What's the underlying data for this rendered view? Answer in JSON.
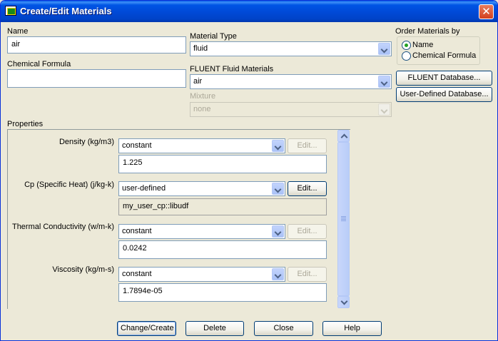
{
  "window": {
    "title": "Create/Edit Materials",
    "close_label": "✕"
  },
  "name": {
    "label": "Name",
    "value": "air"
  },
  "chemical_formula": {
    "label": "Chemical Formula",
    "value": ""
  },
  "material_type": {
    "label": "Material Type",
    "value": "fluid"
  },
  "fluent_fluid_materials": {
    "label": "FLUENT Fluid Materials",
    "value": "air"
  },
  "mixture": {
    "label": "Mixture",
    "value": "none"
  },
  "order_materials": {
    "label": "Order Materials by",
    "options": [
      {
        "label": "Name",
        "checked": true
      },
      {
        "label": "Chemical Formula",
        "checked": false
      }
    ]
  },
  "database_buttons": {
    "fluent": "FLUENT Database...",
    "user_defined": "User-Defined Database..."
  },
  "properties": {
    "label": "Properties",
    "items": [
      {
        "label": "Density (kg/m3)",
        "method": "constant",
        "edit": "Edit...",
        "edit_enabled": false,
        "value": "1.225",
        "value_editable": true
      },
      {
        "label": "Cp (Specific Heat) (j/kg-k)",
        "method": "user-defined",
        "edit": "Edit...",
        "edit_enabled": true,
        "value": "my_user_cp::libudf",
        "value_editable": false
      },
      {
        "label": "Thermal Conductivity (w/m-k)",
        "method": "constant",
        "edit": "Edit...",
        "edit_enabled": false,
        "value": "0.0242",
        "value_editable": true
      },
      {
        "label": "Viscosity (kg/m-s)",
        "method": "constant",
        "edit": "Edit...",
        "edit_enabled": false,
        "value": "1.7894e-05",
        "value_editable": true
      }
    ]
  },
  "footer": {
    "change_create": "Change/Create",
    "delete": "Delete",
    "close": "Close",
    "help": "Help"
  }
}
